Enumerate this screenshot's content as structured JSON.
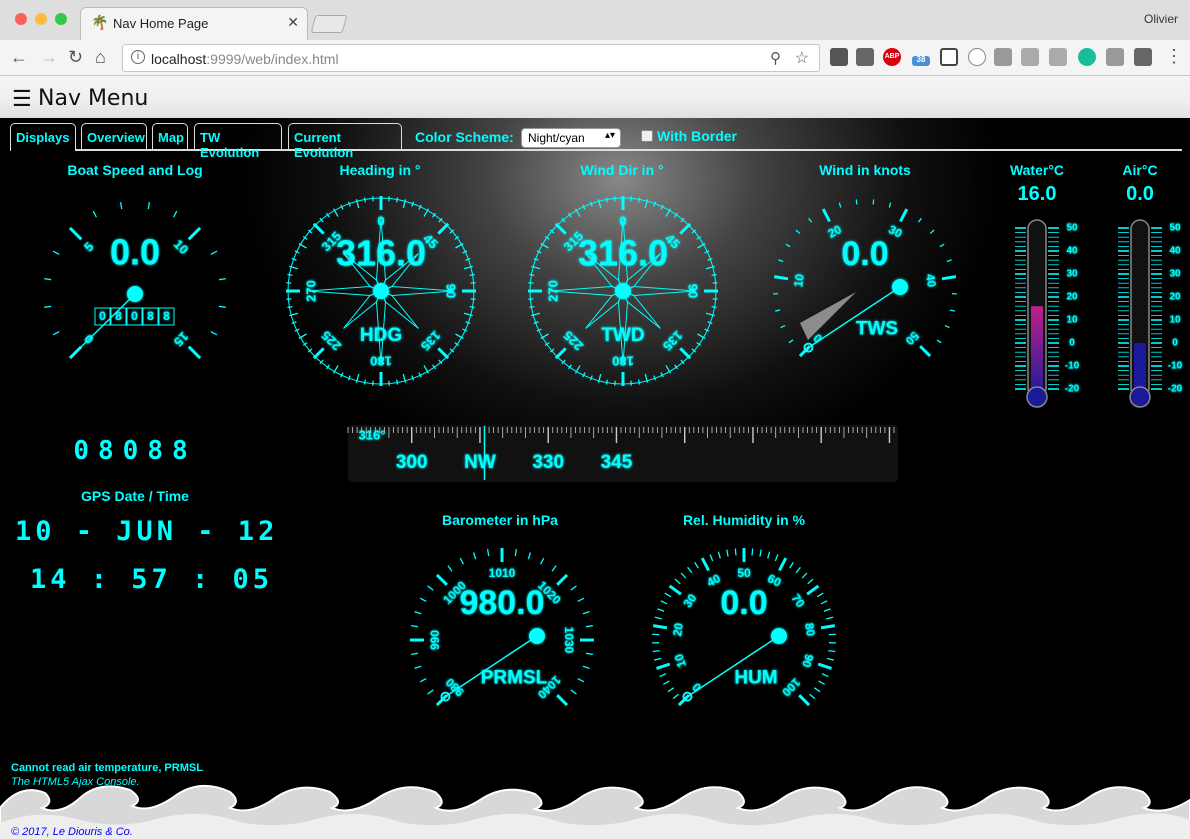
{
  "browser": {
    "tab_title": "Nav Home Page",
    "user": "Olivier",
    "url_host": "localhost",
    "url_path": ":9999/web/index.html",
    "extensions": [
      "evernote-icon",
      "bug-icon",
      "adblock-icon",
      "cloud-icon",
      "screenshot-icon",
      "circle-icon",
      "hash-icon",
      "cube-icon",
      "k-icon",
      "m-icon",
      "h-icon",
      "bookmark-icon"
    ],
    "ext_badge": "38",
    "adblock_label": "ABP"
  },
  "header": {
    "title": "Nav Menu"
  },
  "tabs": [
    {
      "label": "Displays"
    },
    {
      "label": "Overview"
    },
    {
      "label": "Map"
    },
    {
      "label": "TW Evolution"
    },
    {
      "label": "Current Evolution"
    }
  ],
  "scheme": {
    "label": "Color Scheme:",
    "value": "Night/cyan",
    "border_label": "With Border"
  },
  "bsp": {
    "label": "Boat Speed and Log",
    "value": "0.0",
    "log": "08088",
    "ticks": [
      "0",
      "5",
      "10",
      "15"
    ]
  },
  "log_big": "08088",
  "hdg": {
    "label": "Heading in °",
    "value": "316.0",
    "unit": "HDG",
    "ticks": [
      "0",
      "45",
      "90",
      "135",
      "180",
      "225",
      "270",
      "315"
    ]
  },
  "twd": {
    "label": "Wind Dir in °",
    "value": "316.0",
    "unit": "TWD",
    "ticks": [
      "0",
      "45",
      "90",
      "135",
      "180",
      "225",
      "270",
      "315"
    ]
  },
  "tws": {
    "label": "Wind in knots",
    "value": "0.0",
    "unit": "TWS",
    "ticks": [
      "0",
      "10",
      "20",
      "30",
      "40",
      "50"
    ]
  },
  "water": {
    "label": "Water°C",
    "value": "16.0",
    "ticks": [
      "50",
      "40",
      "30",
      "20",
      "10",
      "0",
      "-10",
      "-20"
    ],
    "level": 16
  },
  "air": {
    "label": "Air°C",
    "value": "0.0",
    "ticks": [
      "50",
      "40",
      "30",
      "20",
      "10",
      "0",
      "-10",
      "-20"
    ],
    "level": 0
  },
  "rose": {
    "heading": "316°",
    "labels": [
      "300",
      "NW",
      "330",
      "345"
    ]
  },
  "gps": {
    "label": "GPS Date / Time",
    "date": "10 - JUN - 12",
    "time": "14 : 57 : 05"
  },
  "baro": {
    "label": "Barometer in hPa",
    "value": "980.0",
    "unit": "PRMSL",
    "ticks": [
      "980",
      "990",
      "1000",
      "1010",
      "1020",
      "1030",
      "1040"
    ]
  },
  "hum": {
    "label": "Rel. Humidity in %",
    "value": "0.0",
    "unit": "HUM",
    "ticks": [
      "0",
      "10",
      "20",
      "30",
      "40",
      "50",
      "60",
      "70",
      "80",
      "90",
      "100"
    ]
  },
  "footer": {
    "status": "Cannot read air temperature, PRMSL",
    "subtitle": "The HTML5 Ajax Console.",
    "copyright": "© 2017, Le Diouris & Co."
  }
}
